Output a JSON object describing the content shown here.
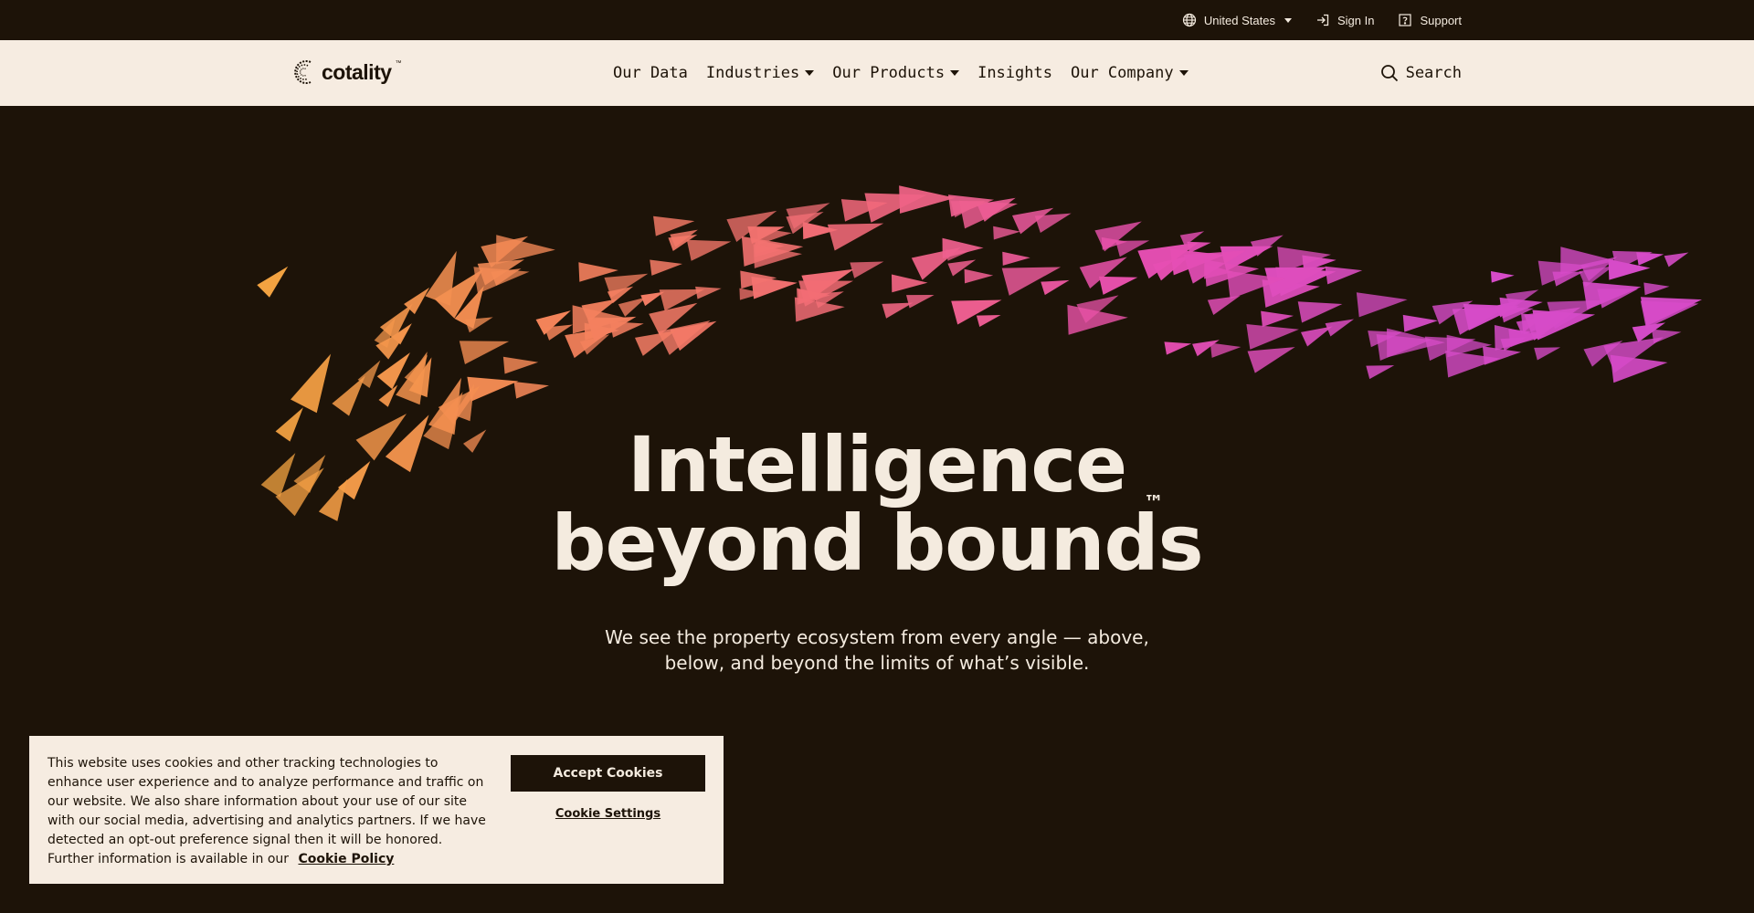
{
  "utility_bar": {
    "region_label": "United States",
    "region_icon": "globe-icon",
    "sign_in_label": "Sign In",
    "sign_in_icon": "sign-in-icon",
    "support_label": "Support",
    "support_icon": "help-icon"
  },
  "nav": {
    "logo_text": "cotality",
    "logo_tm": "™",
    "links": [
      {
        "label": "Our Data",
        "dropdown": false
      },
      {
        "label": "Industries",
        "dropdown": true
      },
      {
        "label": "Our Products",
        "dropdown": true
      },
      {
        "label": "Insights",
        "dropdown": false
      },
      {
        "label": "Our Company",
        "dropdown": true
      }
    ],
    "search_label": "Search",
    "search_icon": "search-icon"
  },
  "hero": {
    "title_line1": "Intelligence",
    "title_line2": "beyond bounds",
    "trademark": "™",
    "subtitle": "We see the property ecosystem from every angle — above, below, and beyond the limits of what’s visible.",
    "gradient_colors": [
      "#f2a340",
      "#f5855a",
      "#f26a78",
      "#e84fb0",
      "#d64bc8"
    ]
  },
  "cookie_banner": {
    "text": "This website uses cookies and other tracking technologies to enhance user experience and to analyze performance and traffic on our website. We also share information about your use of our site with our social media, advertising and analytics partners. If we have detected an opt-out preference signal then it will be honored. Further information is available in our",
    "policy_link": "Cookie Policy",
    "accept_label": "Accept Cookies",
    "settings_label": "Cookie Settings"
  },
  "colors": {
    "background": "#1d1308",
    "nav_bg": "#f6ece1",
    "text_light": "#f4ebdf",
    "text_dark": "#1d1308"
  }
}
